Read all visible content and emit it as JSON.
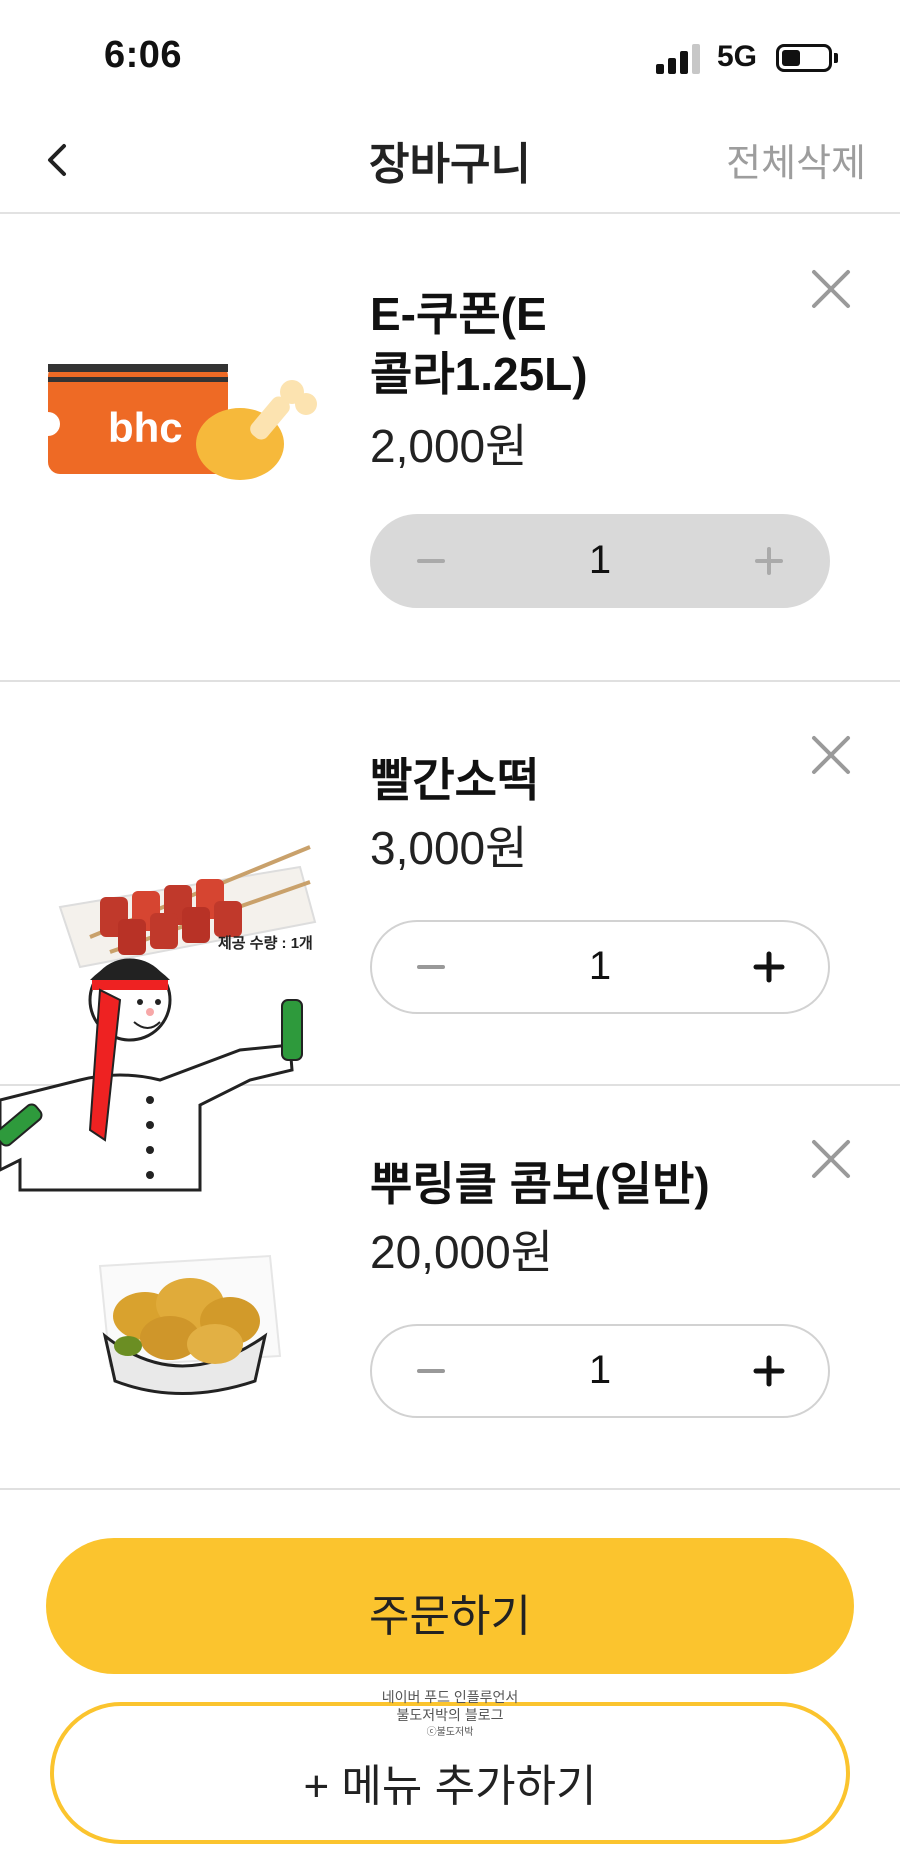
{
  "status_bar": {
    "time": "6:06",
    "network": "5G"
  },
  "header": {
    "title": "장바구니",
    "clear_all": "전체삭제"
  },
  "items": [
    {
      "name": "E-쿠폰(E\n콜라1.25L)",
      "name_line1": "E-쿠폰(E",
      "name_line2": "콜라1.25L)",
      "price": "2,000원",
      "quantity": "1",
      "stepper_enabled": false,
      "logo_text": "bhc"
    },
    {
      "name": "빨간소떡",
      "price": "3,000원",
      "quantity": "1",
      "stepper_enabled": true
    },
    {
      "name": "뿌링클 콤보(일반)",
      "price": "20,000원",
      "quantity": "1",
      "stepper_enabled": true
    }
  ],
  "overlay": {
    "caption": "제공 수량 : 1개",
    "watermark_line1": "네이버 푸드 인플루언서",
    "watermark_line2": "불도저박의 블로그",
    "watermark_sig": "ⓒ불도저박"
  },
  "footer": {
    "order_label": "주문하기",
    "add_menu_label": "+ 메뉴 추가하기"
  },
  "colors": {
    "accent": "#fbc42e",
    "brand_orange": "#ee6a25",
    "divider": "#e0e0e0"
  }
}
